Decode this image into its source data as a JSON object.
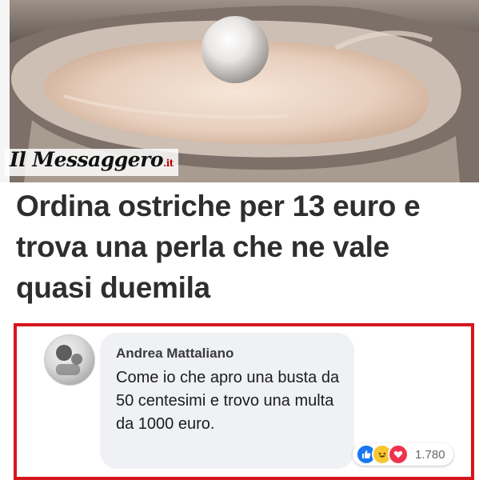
{
  "brand": {
    "name": "Il Messaggero",
    "tld": ".it"
  },
  "headline": "Ordina ostriche per 13 euro e trova una perla che ne vale quasi duemila",
  "comment": {
    "author": "Andrea Mattaliano",
    "text": "Come io che apro una busta da 50 centesimi e trovo una multa da 1000 euro.",
    "reactions": {
      "icons": [
        "like-icon",
        "haha-icon",
        "love-icon"
      ],
      "count": "1.780"
    }
  },
  "colors": {
    "highlight_border": "#d6161c",
    "headline_text": "#2e2e2e",
    "bubble_bg": "#eff1f4",
    "like": "#1877f2",
    "haha": "#f7c631",
    "love": "#f0334b"
  }
}
